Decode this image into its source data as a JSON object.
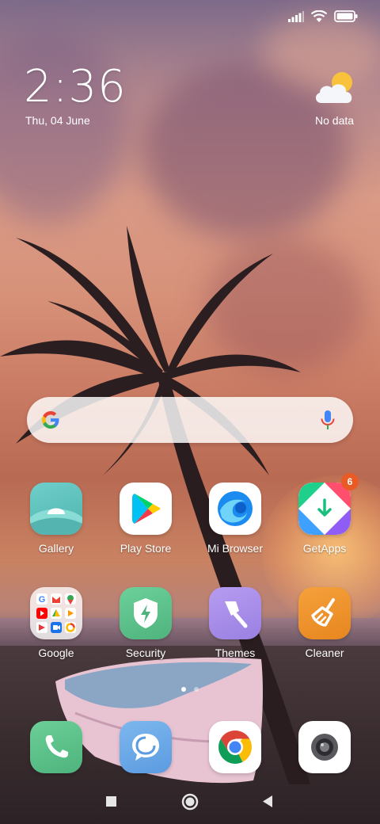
{
  "status_bar": {
    "signal_icon": "signal-icon",
    "wifi_icon": "wifi-icon",
    "battery_icon": "battery-icon"
  },
  "clock": {
    "time": "2:36",
    "date": "Thu, 04 June"
  },
  "weather": {
    "icon": "partly-cloudy-icon",
    "text": "No data"
  },
  "search": {
    "google_icon": "google-g-icon",
    "mic_icon": "microphone-icon"
  },
  "apps": {
    "gallery": {
      "label": "Gallery",
      "icon": "gallery-icon"
    },
    "play_store": {
      "label": "Play Store",
      "icon": "play-store-icon"
    },
    "mi_browser": {
      "label": "Mi Browser",
      "icon": "mi-browser-icon"
    },
    "getapps": {
      "label": "GetApps",
      "icon": "getapps-icon",
      "badge": "6"
    },
    "google": {
      "label": "Google",
      "icon": "google-folder-icon"
    },
    "security": {
      "label": "Security",
      "icon": "security-shield-icon"
    },
    "themes": {
      "label": "Themes",
      "icon": "themes-brush-icon"
    },
    "cleaner": {
      "label": "Cleaner",
      "icon": "cleaner-broom-icon"
    }
  },
  "dock": {
    "phone": {
      "icon": "phone-icon"
    },
    "messages": {
      "icon": "messages-icon"
    },
    "chrome": {
      "icon": "chrome-icon"
    },
    "camera": {
      "icon": "camera-icon"
    }
  },
  "pager": {
    "pages": 2,
    "active": 1
  },
  "nav": {
    "recents_icon": "recents-square-icon",
    "home_icon": "home-circle-icon",
    "back_icon": "back-triangle-icon"
  },
  "colors": {
    "badge": "#ea5a24",
    "gallery": "#5ec3bf",
    "security": "#5dbd8a",
    "themes": "#a58ce6",
    "cleaner": "#f0902a",
    "phone": "#5cc08a",
    "messages": "#6aa8e6"
  }
}
